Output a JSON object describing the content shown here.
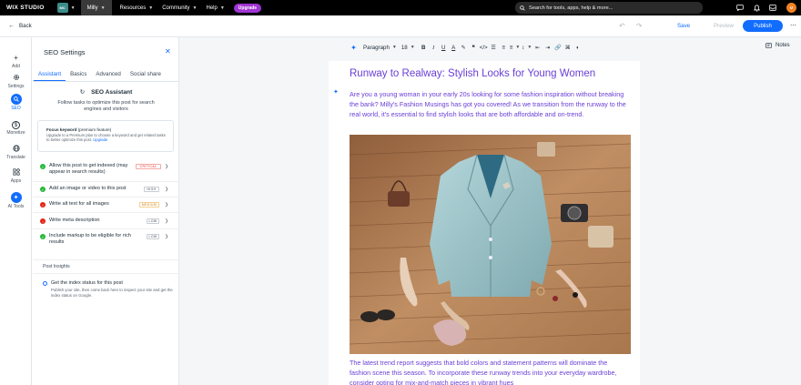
{
  "topbar": {
    "logo": "WIX STUDIO",
    "site_badge": "MC",
    "site_name": "Milly",
    "menu": [
      "Resources",
      "Community",
      "Help"
    ],
    "upgrade_label": "Upgrade",
    "search_placeholder": "Search for tools, apps, help & more...",
    "avatar_initials": "M"
  },
  "subbar": {
    "back_label": "Back",
    "save_label": "Save",
    "preview_label": "Preview",
    "publish_label": "Publish"
  },
  "rail": {
    "items": [
      {
        "label": "Add",
        "icon": "plus-icon"
      },
      {
        "label": "Settings",
        "icon": "gear-icon"
      },
      {
        "label": "SEO",
        "icon": "search-icon"
      },
      {
        "label": "Monetize",
        "icon": "dollar-icon"
      },
      {
        "label": "Translate",
        "icon": "globe-icon"
      },
      {
        "label": "Apps",
        "icon": "apps-icon"
      },
      {
        "label": "AI Tools",
        "icon": "sparkle-icon"
      }
    ]
  },
  "seo_panel": {
    "title": "SEO Settings",
    "tabs": [
      "Assistant",
      "Basics",
      "Advanced",
      "Social share"
    ],
    "assistant_title": "SEO Assistant",
    "assistant_subtitle": "Follow tasks to optimize this post for search engines and visitors",
    "focus_keyword": {
      "title": "Focus keyword",
      "premium_note": "(premium feature)",
      "description": "Upgrade to a Premium plan to choose a keyword and get related tasks to better optimize this post.",
      "link": "Upgrade"
    },
    "checks": [
      {
        "label": "Allow this post to get indexed (may appear in search results)",
        "status": "ok",
        "priority": "CRITICAL"
      },
      {
        "label": "Add an image or video to this post",
        "status": "ok",
        "priority": "HIGH"
      },
      {
        "label": "Write alt text for all images",
        "status": "bad",
        "priority": "MEDIUM"
      },
      {
        "label": "Write meta description",
        "status": "bad",
        "priority": "LOW"
      },
      {
        "label": "Include markup to be eligible for rich results",
        "status": "ok",
        "priority": "LOW"
      }
    ],
    "insights_title": "Post Insights",
    "insight": {
      "title": "Get the index status for this post",
      "description": "Publish your site, then come back here to inspect your site and get the index status on Google."
    }
  },
  "toolbar": {
    "paragraph": "Paragraph",
    "font_size": "18",
    "notes_label": "Notes"
  },
  "post": {
    "title": "Runway to Realway: Stylish Looks for Young Women",
    "intro": "Are you a young woman in your early 20s looking for some fashion inspiration without breaking the bank? Milly's Fashion Musings has got you covered! As we transition from the runway to the real world, it's essential to find stylish looks that are both affordable and on-trend.",
    "body": "The latest trend report suggests that bold colors and statement patterns will dominate the fashion scene this season. To incorporate these runway trends into your everyday wardrobe, consider opting for mix-and-match pieces in vibrant hues"
  }
}
